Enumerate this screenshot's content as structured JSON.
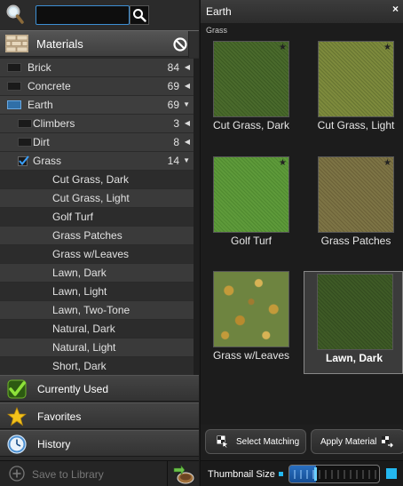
{
  "search": {
    "value": "",
    "placeholder": ""
  },
  "materials_header": {
    "title": "Materials"
  },
  "tree": [
    {
      "label": "Brick",
      "count": "84",
      "arrow": "◀",
      "level": 0,
      "swatch": true,
      "checked": false,
      "bg": "alt"
    },
    {
      "label": "Concrete",
      "count": "69",
      "arrow": "◀",
      "level": 0,
      "swatch": true,
      "checked": false,
      "bg": "alt"
    },
    {
      "label": "Earth",
      "count": "69",
      "arrow": "▼",
      "level": 0,
      "swatch": true,
      "checked": false,
      "bg": "alt",
      "highlight": true
    },
    {
      "label": "Climbers",
      "count": "3",
      "arrow": "◀",
      "level": 1,
      "swatch": true,
      "checked": false,
      "bg": "alt"
    },
    {
      "label": "Dirt",
      "count": "8",
      "arrow": "◀",
      "level": 1,
      "swatch": true,
      "checked": false,
      "bg": "alt"
    },
    {
      "label": "Grass",
      "count": "14",
      "arrow": "▼",
      "level": 1,
      "swatch": false,
      "checked": true,
      "bg": "alt"
    },
    {
      "label": "Cut Grass, Dark",
      "level": 2,
      "bg": "plain"
    },
    {
      "label": "Cut Grass, Light",
      "level": 2,
      "bg": "alt"
    },
    {
      "label": "Golf Turf",
      "level": 2,
      "bg": "plain"
    },
    {
      "label": "Grass Patches",
      "level": 2,
      "bg": "alt"
    },
    {
      "label": "Grass w/Leaves",
      "level": 2,
      "bg": "plain"
    },
    {
      "label": "Lawn, Dark",
      "level": 2,
      "bg": "alt"
    },
    {
      "label": "Lawn, Light",
      "level": 2,
      "bg": "plain"
    },
    {
      "label": "Lawn, Two-Tone",
      "level": 2,
      "bg": "alt"
    },
    {
      "label": "Natural, Dark",
      "level": 2,
      "bg": "plain"
    },
    {
      "label": "Natural, Light",
      "level": 2,
      "bg": "alt"
    },
    {
      "label": "Short, Dark",
      "level": 2,
      "bg": "plain"
    }
  ],
  "nav": {
    "currently_used": "Currently Used",
    "favorites": "Favorites",
    "history": "History"
  },
  "footer_left": {
    "save_label": "Save to Library"
  },
  "panel": {
    "title": "Earth",
    "close": "×",
    "subtitle": "Grass",
    "tiles": [
      {
        "name": "Cut Grass, Dark",
        "color": "#4a6a2c",
        "color2": "#3b5a22",
        "starred": true,
        "selected": false
      },
      {
        "name": "Cut Grass, Light",
        "color": "#7d8a3c",
        "color2": "#677532",
        "starred": true,
        "selected": false
      },
      {
        "name": "Golf Turf",
        "color": "#5e9a3a",
        "color2": "#4f8a30",
        "starred": true,
        "selected": false
      },
      {
        "name": "Grass Patches",
        "color": "#7d7445",
        "color2": "#6b6138",
        "starred": true,
        "selected": false
      },
      {
        "name": "Grass w/Leaves",
        "color": "#6e8440",
        "color2": "#c39a3a",
        "starred": false,
        "selected": false
      },
      {
        "name": "Lawn, Dark",
        "color": "#3e5a26",
        "color2": "#334c1f",
        "starred": false,
        "selected": true
      }
    ]
  },
  "actions": {
    "select_matching": "Select Matching",
    "apply_material": "Apply Material"
  },
  "footer_right": {
    "thumbnail_label": "Thumbnail Size",
    "thumbnail_size": 0.3
  },
  "colors": {
    "accent": "#24b8f0",
    "check": "#7ccc2a",
    "star": "#f2c21b"
  }
}
